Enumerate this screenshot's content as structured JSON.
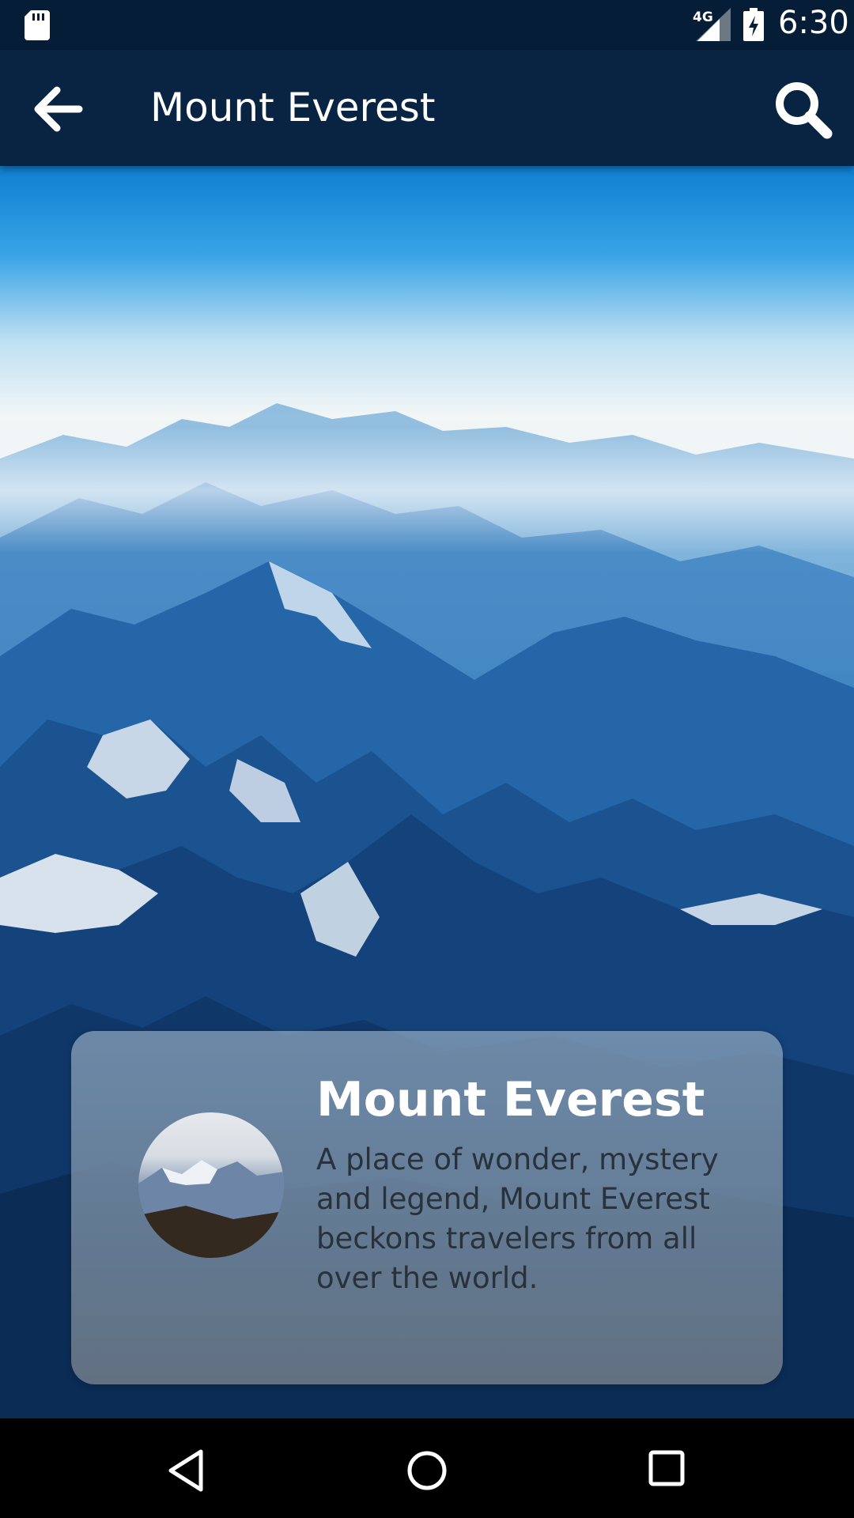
{
  "status_bar": {
    "network_type": "4G",
    "time": "6:30",
    "icons": [
      "sd-card-icon",
      "signal-icon",
      "battery-charging-icon"
    ]
  },
  "app_bar": {
    "title": "Mount Everest",
    "back_icon": "arrow-left-icon",
    "search_icon": "search-icon",
    "background": "#082442"
  },
  "card": {
    "title": "Mount Everest",
    "description": "A place of wonder, mystery and legend, Mount Everest beckons travelers from all over the world."
  },
  "nav_bar": {
    "icons": [
      "back-triangle-icon",
      "home-circle-icon",
      "recents-square-icon"
    ]
  },
  "colors": {
    "status_bar": "#061d37",
    "app_bar": "#082442",
    "card_text": "#29323b"
  }
}
